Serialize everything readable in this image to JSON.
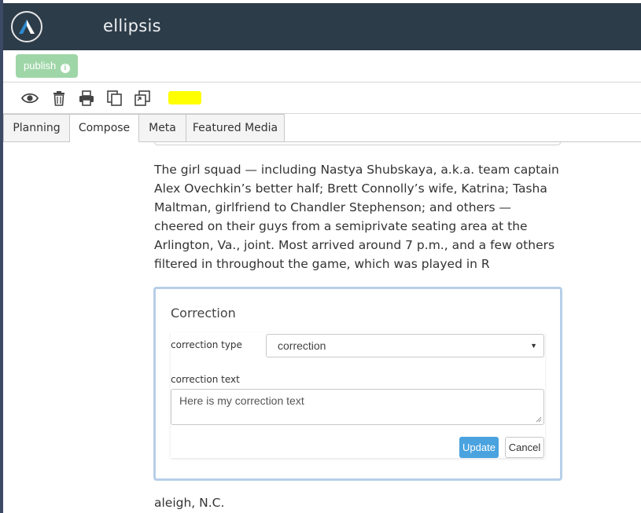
{
  "app": {
    "title": "ellipsis",
    "logo_icon": "ellipsis-logo-icon",
    "header_color": "#2d3c49"
  },
  "publish": {
    "label": "publish",
    "info_icon": "info-icon",
    "info_glyph": "i",
    "color": "#9fd6a8"
  },
  "toolbar": {
    "icons": [
      "eye-icon",
      "trash-icon",
      "print-icon",
      "copy-icon",
      "duplicate-icon"
    ],
    "highlight_color": "#ffff00"
  },
  "tabs": [
    {
      "label": "Planning",
      "active": false
    },
    {
      "label": "Compose",
      "active": true
    },
    {
      "label": "Meta",
      "active": false
    },
    {
      "label": "Featured Media",
      "active": false
    }
  ],
  "content": {
    "paragraph_1": "The girl squad — including Nastya Shubskaya, a.k.a. team captain Alex Ovechkin’s better half; Brett Connolly’s wife, Katrina; Tasha Maltman, girlfriend to Chandler Stephenson; and others — cheered on their guys from a semiprivate seating area at the Arlington, Va., joint. Most arrived around 7 p.m., and a few others filtered in throughout the game, which was played in R",
    "paragraph_2": "aleigh, N.C."
  },
  "correction": {
    "title": "Correction",
    "type_label": "correction type",
    "type_value": "correction",
    "text_label": "correction text",
    "text_value": "Here is my correction text",
    "update_label": "Update",
    "cancel_label": "Cancel",
    "border_color": "#b7cfe8",
    "update_color": "#4aa3df"
  }
}
